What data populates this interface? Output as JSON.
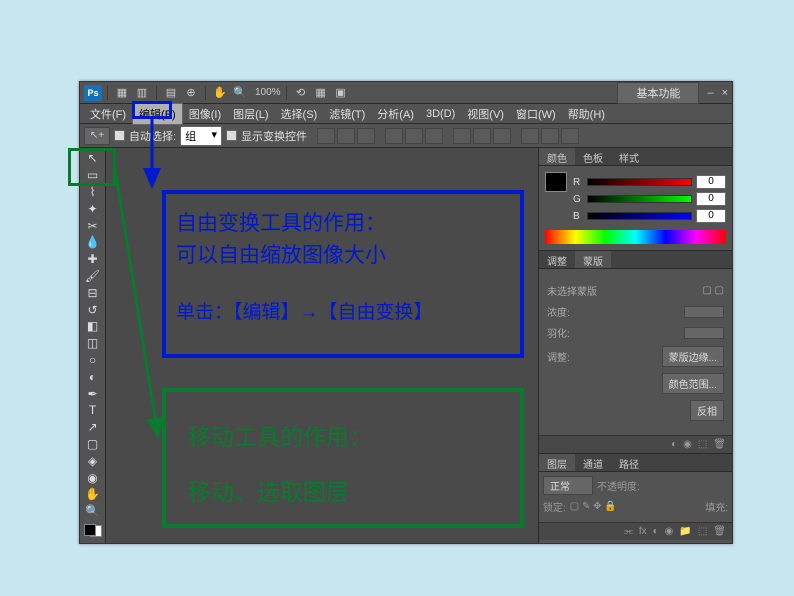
{
  "iconbar": {
    "logo": "Ps",
    "zoom": "100%",
    "workspace": "基本功能",
    "min": "–",
    "close": "×"
  },
  "menu": {
    "file": "文件(F)",
    "edit": "编辑(E)",
    "image": "图像(I)",
    "layer": "图层(L)",
    "select": "选择(S)",
    "filter": "滤镜(T)",
    "analysis": "分析(A)",
    "threed": "3D(D)",
    "view": "视图(V)",
    "window": "窗口(W)",
    "help": "帮助(H)"
  },
  "options": {
    "autoselect": "自动选择:",
    "group": "组",
    "show_transform": "显示变换控件"
  },
  "panels": {
    "color": {
      "tabs": [
        "颜色",
        "色板",
        "样式"
      ],
      "r": "R",
      "g": "G",
      "b": "B",
      "rv": "0",
      "gv": "0",
      "bv": "0"
    },
    "adj": {
      "tabs": [
        "调整",
        "蒙版"
      ],
      "nomask": "未选择蒙版",
      "density": "浓度:",
      "feather": "羽化:",
      "edge": "调整:",
      "maskedge": "蒙版边缘...",
      "colorrange": "颜色范围...",
      "invert": "反相"
    },
    "layers": {
      "tabs": [
        "图层",
        "通道",
        "路径"
      ],
      "mode": "正常",
      "opacity_lbl": "不透明度:",
      "lock_lbl": "锁定:",
      "fill_lbl": "填充:"
    }
  },
  "anno": {
    "blue_l1": "自由变换工具的作用：",
    "blue_l2": "可以自由缩放图像大小",
    "blue_l3": "单击：【编辑】→【自由变换】",
    "green_l1": "移动工具的作用：",
    "green_l2": "移动、选取图层"
  }
}
